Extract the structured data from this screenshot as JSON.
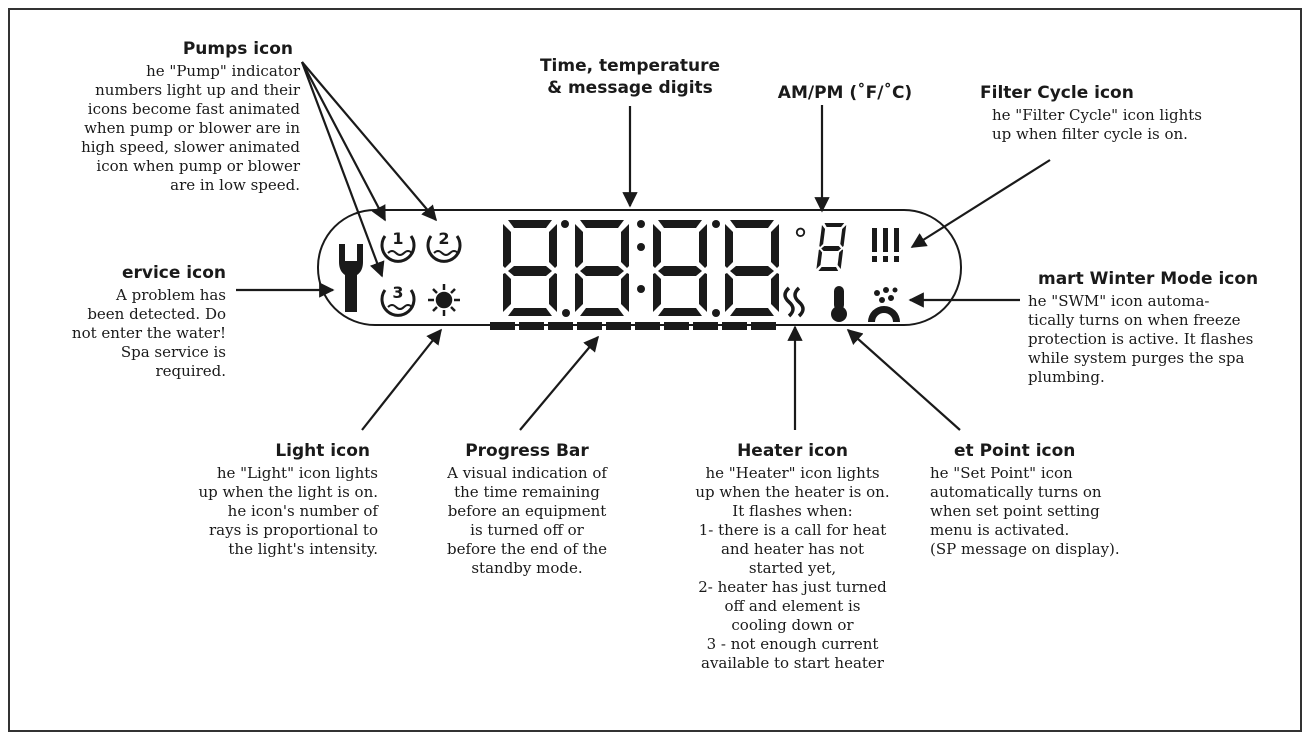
{
  "colors": {
    "ink": "#1a1a1a",
    "frame": "#333333",
    "background": "#ffffff"
  },
  "display": {
    "digits": "8.8:8.8",
    "degree_symbol": "°",
    "icons": [
      "wrench-icon",
      "pump-1-icon",
      "pump-2-icon",
      "pump-3-icon",
      "light-icon",
      "ampm-unit-digit",
      "filter-cycle-icon",
      "heater-icon",
      "set-point-icon",
      "smart-winter-mode-icon"
    ],
    "pump_numbers": [
      "1",
      "2",
      "3"
    ],
    "progress_segments": 10
  },
  "labels": {
    "pumps": {
      "title": "Pumps icon",
      "text": "he \"Pump\" indicator\nnumbers light up and their\nicons become fast animated\nwhen pump or blower are in\nhigh speed, slower animated\nicon when pump or blower\nare in low speed."
    },
    "time": {
      "title": "Time, temperature\n& message digits"
    },
    "ampm": {
      "title": "AM/PM (˚F/˚C)"
    },
    "filter": {
      "title": "Filter Cycle icon",
      "text": "he \"Filter Cycle\" icon lights\nup when filter cycle is on."
    },
    "service": {
      "title": "ervice icon",
      "text": "A problem has\nbeen detected. Do\nnot enter the water!\nSpa service is\nrequired."
    },
    "winter": {
      "title": "mart Winter Mode icon",
      "text": "he \"SWM\" icon automa-\ntically turns on when freeze\nprotection is active. It flashes\nwhile system purges the spa\nplumbing."
    },
    "light": {
      "title": "Light icon",
      "text": "he \"Light\" icon lights\nup when the light is on.\nhe icon's number of\nrays is proportional to\nthe light's intensity."
    },
    "progress": {
      "title": "Progress Bar",
      "text": "A visual indication of\nthe time remaining\nbefore an equipment\nis turned off or\nbefore the end of the\nstandby mode."
    },
    "heater": {
      "title": "Heater icon",
      "text": "he \"Heater\" icon lights\nup when the heater is on.\nIt flashes when:\n1- there is a call for heat\nand heater has not\nstarted yet,\n2- heater has just turned\noff and element is\ncooling down or\n3 - not enough current\navailable to start heater"
    },
    "setpoint": {
      "title": "et Point icon",
      "text": "he \"Set Point\" icon\nautomatically turns on\nwhen set point setting\nmenu is activated.\n(SP message on display)."
    }
  }
}
